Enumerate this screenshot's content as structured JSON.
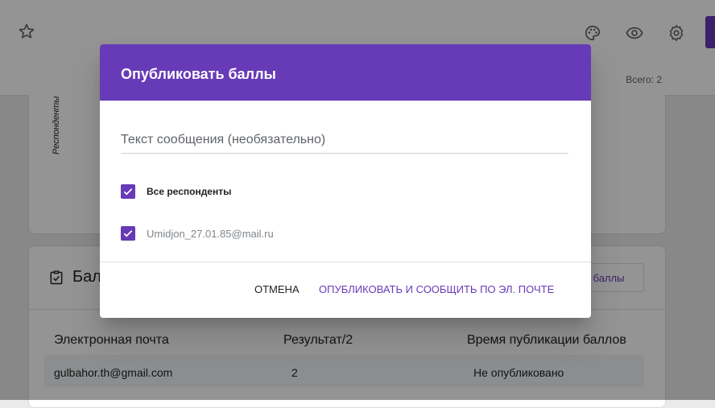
{
  "header": {
    "right_icons": [
      "palette-icon",
      "eye-icon",
      "gear-icon"
    ]
  },
  "subbar": {
    "total_label": "Всего: 2"
  },
  "respondents_card": {
    "vertical_label": "Респонденты"
  },
  "scores_card": {
    "title_partial": "Бал",
    "publish_button_partial": "баллы",
    "columns": [
      "Электронная почта",
      "Результат/2",
      "Время публикации баллов"
    ],
    "rows": [
      {
        "email": "gulbahor.th@gmail.com",
        "score": "2",
        "status": "Не опубликовано"
      }
    ]
  },
  "dialog": {
    "title": "Опубликовать баллы",
    "message_placeholder": "Текст сообщения (необязательно)",
    "all_respondents_label": "Все респонденты",
    "respondent_email": "Umidjon_27.01.85@mail.ru",
    "cancel_label": "ОТМЕНА",
    "publish_label": "ОПУБЛИКОВАТЬ И СООБЩИТЬ ПО ЭЛ. ПОЧТЕ"
  },
  "colors": {
    "accent": "#673ab7"
  }
}
